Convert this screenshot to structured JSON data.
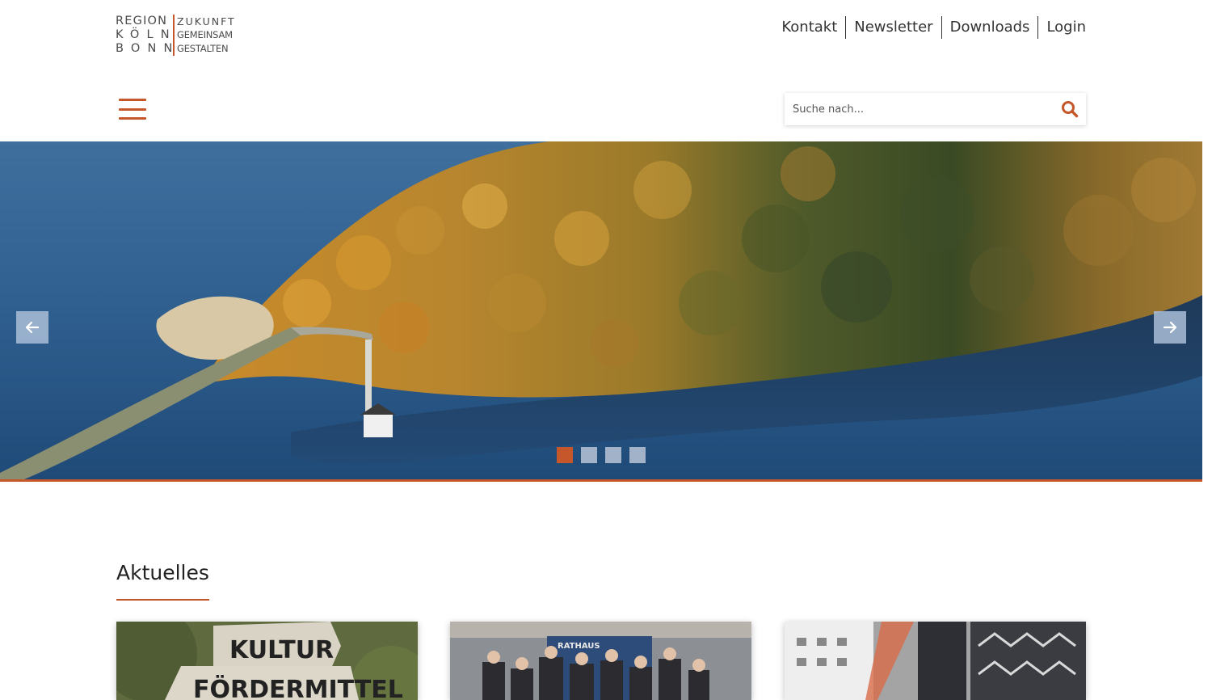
{
  "header": {
    "logo": {
      "left_lines": [
        "REGION",
        "KÖLN",
        "BONN"
      ],
      "right_lines": [
        "ZUKUNFT",
        "GEMEINSAM",
        "GESTALTEN"
      ]
    },
    "topnav": [
      {
        "label": "Kontakt"
      },
      {
        "label": "Newsletter"
      },
      {
        "label": "Downloads"
      },
      {
        "label": "Login"
      }
    ],
    "search": {
      "placeholder": "Suche nach..."
    }
  },
  "hero": {
    "slide_count": 4,
    "active_slide": 1,
    "icons": {
      "prev": "arrow-left-icon",
      "next": "arrow-right-icon"
    }
  },
  "news": {
    "title": "Aktuelles",
    "cards": [
      {
        "sign_top": "KULTUR",
        "sign_bottom": "FÖRDERMITTEL"
      },
      {
        "sign_top": "RATHAUS"
      },
      {}
    ]
  },
  "colors": {
    "accent": "#c5572a",
    "text": "#333333",
    "water": "#2e5d8c"
  }
}
